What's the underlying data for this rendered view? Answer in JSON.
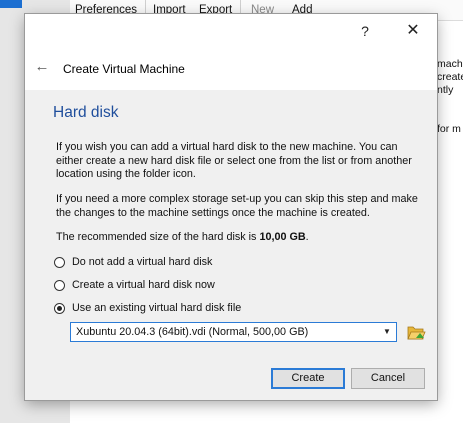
{
  "background_app": {
    "toolbar": [
      {
        "label": "Preferences",
        "enabled": true
      },
      {
        "label": "Import",
        "enabled": true
      },
      {
        "label": "Export",
        "enabled": true
      },
      {
        "label": "New",
        "enabled": false
      },
      {
        "label": "Add",
        "enabled": true
      }
    ],
    "side_text": [
      "machine",
      "create n",
      "ntly",
      "for m"
    ]
  },
  "dialog": {
    "help_glyph": "?",
    "close_glyph": "✕",
    "back_glyph": "←",
    "title": "Create Virtual Machine",
    "section_title": "Hard disk",
    "paragraph1": "If you wish you can add a virtual hard disk to the new machine. You can either create a new hard disk file or select one from the list or from another location using the folder icon.",
    "paragraph2": "If you need a more complex storage set-up you can skip this step and make the changes to the machine settings once the machine is created.",
    "recommended_prefix": "The recommended size of the hard disk is ",
    "recommended_size": "10,00 GB",
    "recommended_suffix": ".",
    "options": [
      {
        "label": "Do not add a virtual hard disk",
        "checked": false
      },
      {
        "label": "Create a virtual hard disk now",
        "checked": false
      },
      {
        "label": "Use an existing virtual hard disk file",
        "checked": true
      }
    ],
    "disk_select": {
      "value": "Xubuntu 20.04.3 (64bit).vdi (Normal, 500,00 GB)",
      "arrow_glyph": "▼"
    },
    "folder_icon": "folder-open-icon",
    "buttons": {
      "create": "Create",
      "cancel": "Cancel"
    },
    "colors": {
      "section_title": "#1f4e9c",
      "focus_border": "#2b7bd6",
      "folder_yellow": "#e7b73a",
      "folder_green": "#3fa535"
    }
  }
}
